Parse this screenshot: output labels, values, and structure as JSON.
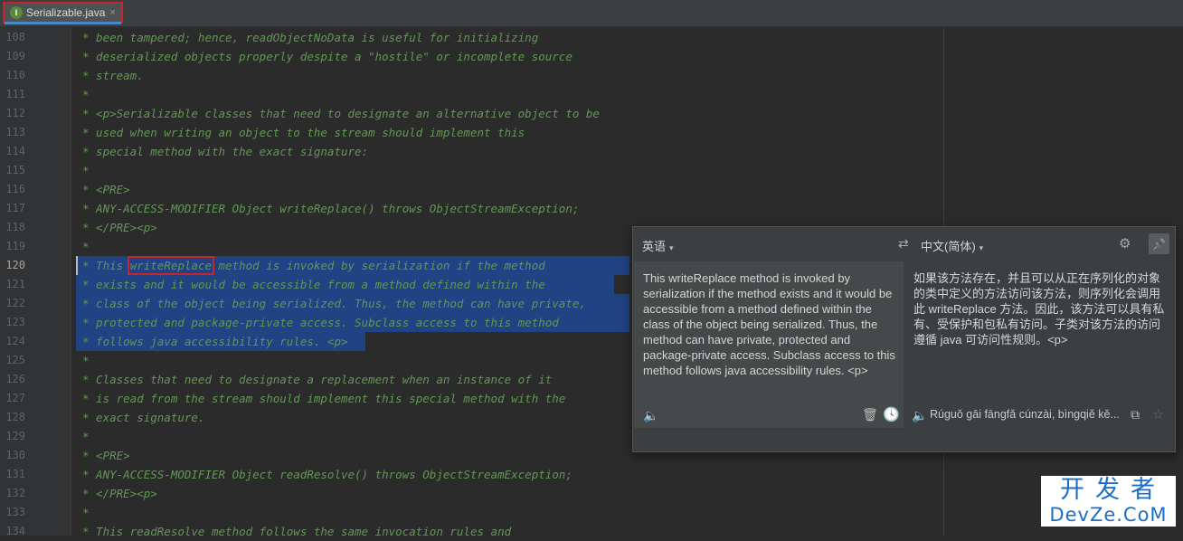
{
  "tab": {
    "icon_letter": "I",
    "label": "Serializable.java",
    "close": "×"
  },
  "editor": {
    "current_line": "120",
    "lines": [
      {
        "n": "108",
        "text": "* been tampered; hence, readObjectNoData is useful for initializing"
      },
      {
        "n": "109",
        "text": "* deserialized objects properly despite a \"hostile\" or incomplete source"
      },
      {
        "n": "110",
        "text": "* stream."
      },
      {
        "n": "111",
        "text": "*"
      },
      {
        "n": "112",
        "text": "* <p>Serializable classes that need to designate an alternative object to be"
      },
      {
        "n": "113",
        "text": "* used when writing an object to the stream should implement this"
      },
      {
        "n": "114",
        "text": "* special method with the exact signature:"
      },
      {
        "n": "115",
        "text": "*"
      },
      {
        "n": "116",
        "text": "* <PRE>"
      },
      {
        "n": "117",
        "text": "* ANY-ACCESS-MODIFIER Object writeReplace() throws ObjectStreamException;"
      },
      {
        "n": "118",
        "text": "* </PRE><p>"
      },
      {
        "n": "119",
        "text": "*"
      },
      {
        "n": "120",
        "text_pre": "* This ",
        "text_box": "writeReplace",
        "text_post": " method is invoked by serialization if the method"
      },
      {
        "n": "121",
        "text": "* exists and it would be accessible from a method defined within the"
      },
      {
        "n": "122",
        "text": "* class of the object being serialized. Thus, the method can have private,"
      },
      {
        "n": "123",
        "text": "* protected and package-private access. Subclass access to this method"
      },
      {
        "n": "124",
        "text": "* follows java accessibility rules. <p>"
      },
      {
        "n": "125",
        "text": "*"
      },
      {
        "n": "126",
        "text": "* Classes that need to designate a replacement when an instance of it"
      },
      {
        "n": "127",
        "text": "* is read from the stream should implement this special method with the"
      },
      {
        "n": "128",
        "text": "* exact signature."
      },
      {
        "n": "129",
        "text": "*"
      },
      {
        "n": "130",
        "text": "* <PRE>"
      },
      {
        "n": "131",
        "text": "* ANY-ACCESS-MODIFIER Object readResolve() throws ObjectStreamException;"
      },
      {
        "n": "132",
        "text": "* </PRE><p>"
      },
      {
        "n": "133",
        "text": "*"
      },
      {
        "n": "134",
        "text": "* This readResolve method follows the same invocation rules and"
      }
    ]
  },
  "translator": {
    "source_lang": "英语",
    "target_lang": "中文(简体)",
    "source_text": "This writeReplace method is invoked by serialization if the method exists and it would be accessible from a method defined within the class of the object being serialized. Thus, the method can have private, protected and package-private access. Subclass access to this method follows java accessibility rules. <p>",
    "target_text": "如果该方法存在，并且可以从正在序列化的对象的类中定义的方法访问该方法，则序列化会调用此 writeReplace 方法。因此，该方法可以具有私有、受保护和包私有访问。子类对该方法的访问遵循 java 可访问性规则。<p>",
    "transliteration": "Rúguǒ gāi fāngfǎ cúnzài, bìngqiě kě...",
    "icons": {
      "dropdown": "▾",
      "swap": "⇄",
      "gear": "⚙",
      "pin": "📌",
      "speaker": "🔈",
      "trash": "🗑",
      "history": "🕓",
      "copy": "⧉",
      "star": "☆"
    }
  },
  "watermark": {
    "cn": "开发者",
    "en": "DevZe.CoM"
  },
  "colors": {
    "comment": "#629755",
    "selection": "#214283",
    "highlight_box": "#c3262b",
    "tab_accent": "#4a88c7"
  }
}
